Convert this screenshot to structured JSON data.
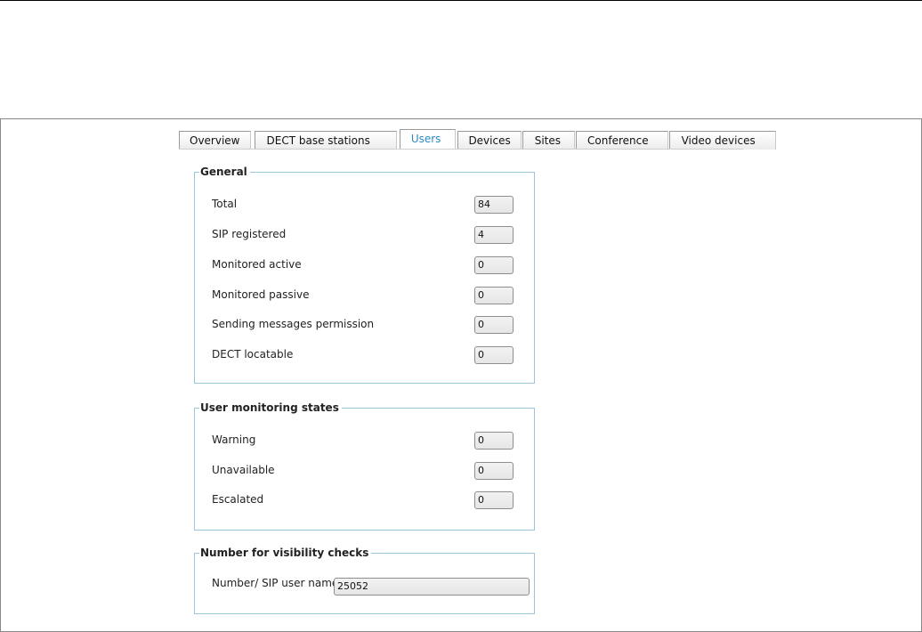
{
  "tabs": [
    {
      "label": "Overview",
      "active": false
    },
    {
      "label": "DECT base stations",
      "active": false
    },
    {
      "label": "Users",
      "active": true
    },
    {
      "label": "Devices",
      "active": false
    },
    {
      "label": "Sites",
      "active": false
    },
    {
      "label": "Conference",
      "active": false
    },
    {
      "label": "Video devices",
      "active": false
    }
  ],
  "general": {
    "title": "General",
    "rows": [
      {
        "label": "Total",
        "value": "84"
      },
      {
        "label": "SIP registered",
        "value": "4"
      },
      {
        "label": "Monitored active",
        "value": "0"
      },
      {
        "label": "Monitored passive",
        "value": "0"
      },
      {
        "label": "Sending messages permission",
        "value": "0"
      },
      {
        "label": "DECT locatable",
        "value": "0"
      }
    ]
  },
  "monitoring": {
    "title": "User monitoring states",
    "rows": [
      {
        "label": "Warning",
        "value": "0"
      },
      {
        "label": "Unavailable",
        "value": "0"
      },
      {
        "label": "Escalated",
        "value": "0"
      }
    ]
  },
  "visibility": {
    "title": "Number for visibility checks",
    "label": "Number/ SIP user name",
    "value": "25052"
  },
  "colors": {
    "active_tab": "#2a8bc4",
    "group_border": "#9cc6de"
  }
}
